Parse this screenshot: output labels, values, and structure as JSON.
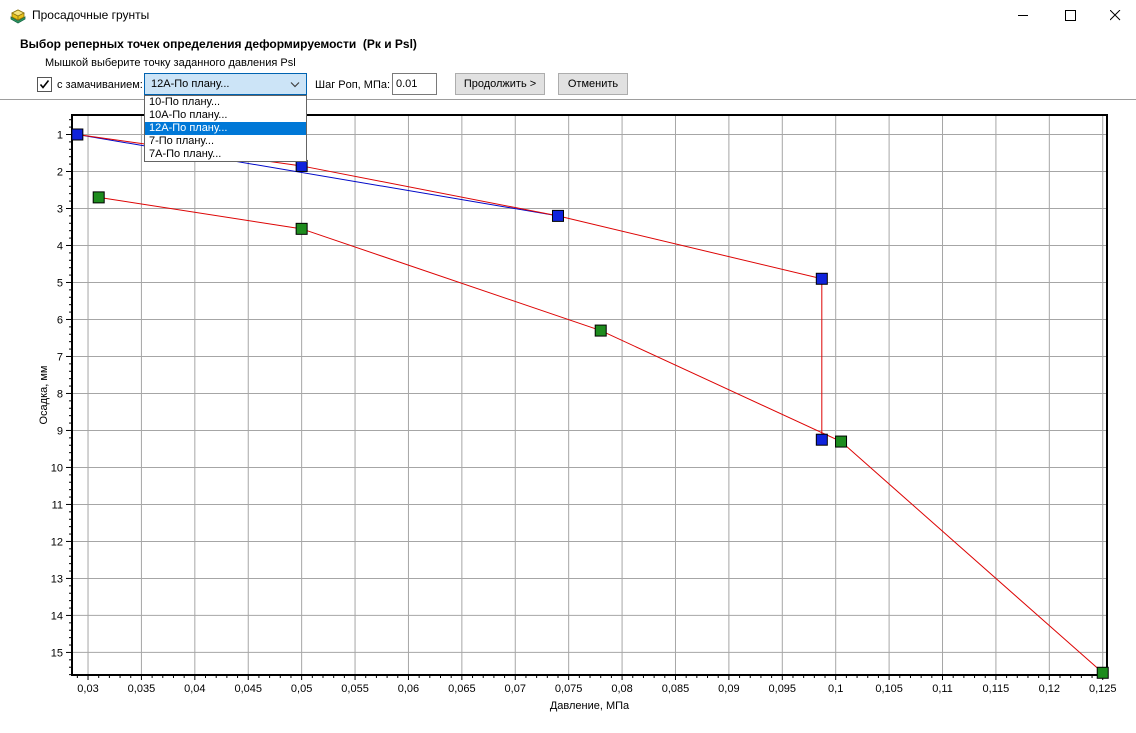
{
  "window": {
    "title": "Просадочные грунты"
  },
  "header": {
    "title": "Выбор реперных точек определения деформируемости  (Рк и Psl)",
    "subtitle": "Мышкой выберите точку заданного давления Psl"
  },
  "toolbar": {
    "soak_label": "с замачиванием:",
    "soak_checked": true,
    "sample_value": "12А-По плану...",
    "sample_options": [
      "10-По плану...",
      "10А-По плану...",
      "12А-По плану...",
      "7-По плану...",
      "7А-По плану..."
    ],
    "selected_option_index": 2,
    "step_label": "Шаг Pоп, МПа:",
    "step_value": "0.01",
    "continue_label": "Продолжить >",
    "cancel_label": "Отменить"
  },
  "chart_data": {
    "type": "line",
    "title": "",
    "xlabel": "Давление, МПа",
    "ylabel": "Осадка, мм",
    "xlim": [
      0.0285,
      0.1254
    ],
    "ylim": [
      0.473,
      15.61
    ],
    "y_inverted": true,
    "grid": true,
    "x_tick_values": [
      0.03,
      0.035,
      0.04,
      0.045,
      0.05,
      0.055,
      0.06,
      0.065,
      0.07,
      0.075,
      0.08,
      0.085,
      0.09,
      0.095,
      0.1,
      0.105,
      0.11,
      0.115,
      0.12,
      0.125
    ],
    "x_tick_labels": [
      "0,03",
      "0,035",
      "0,04",
      "0,045",
      "0,05",
      "0,055",
      "0,06",
      "0,065",
      "0,07",
      "0,075",
      "0,08",
      "0,085",
      "0,09",
      "0,095",
      "0,1",
      "0,105",
      "0,11",
      "0,115",
      "0,12",
      "0,125"
    ],
    "y_tick_values": [
      1,
      2,
      3,
      4,
      5,
      6,
      7,
      8,
      9,
      10,
      11,
      12,
      13,
      14,
      15
    ],
    "y_tick_labels": [
      "1",
      "2",
      "3",
      "4",
      "5",
      "6",
      "7",
      "8",
      "9",
      "10",
      "11",
      "12",
      "13",
      "14",
      "15"
    ],
    "x_minor_step": 0.001,
    "y_minor_step": 0.2,
    "colors": {
      "grid": "#a6a6a6",
      "axis": "#000000",
      "red_line": "#dd0404",
      "blue_line": "#0008c8",
      "blue_marker": "#1023dc",
      "green_marker": "#1e8c1e"
    },
    "series": [
      {
        "name": "secant-blue-line",
        "marker": "none",
        "line_color": "#0008c8",
        "points": [
          [
            0.029,
            1.0
          ],
          [
            0.074,
            3.2
          ]
        ]
      },
      {
        "name": "curve-blue-squares",
        "marker": "square",
        "marker_color": "#1023dc",
        "line_color": "#dd0404",
        "points": [
          [
            0.029,
            1.0
          ],
          [
            0.05,
            1.85
          ],
          [
            0.074,
            3.2
          ],
          [
            0.0987,
            4.9
          ],
          [
            0.0987,
            9.25
          ]
        ]
      },
      {
        "name": "curve-green-squares",
        "marker": "square",
        "marker_color": "#1e8c1e",
        "line_color": "#dd0404",
        "points": [
          [
            0.031,
            2.7
          ],
          [
            0.05,
            3.55
          ],
          [
            0.078,
            6.3
          ],
          [
            0.1005,
            9.3
          ],
          [
            0.125,
            15.55
          ]
        ]
      }
    ]
  }
}
